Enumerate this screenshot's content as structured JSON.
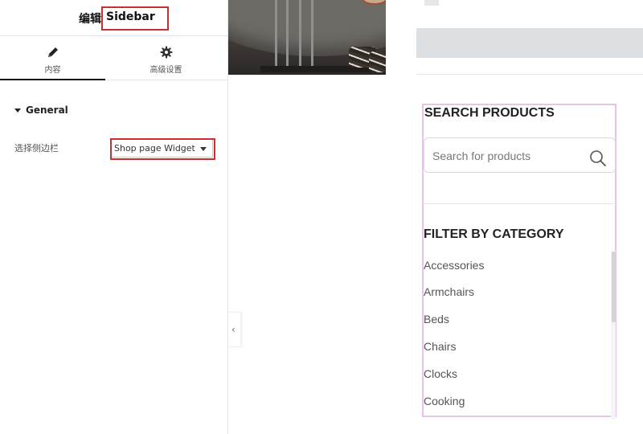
{
  "editor": {
    "title_prefix": "编辑",
    "title_name": "Sidebar",
    "tabs": [
      {
        "label": "内容",
        "icon": "pencil-icon"
      },
      {
        "label": "高级设置",
        "icon": "gear-icon"
      }
    ],
    "section": {
      "label": "General"
    },
    "sidebar_field": {
      "label": "选择侧边栏",
      "value": "Shop page Widget Area"
    },
    "collapse_glyph": "‹"
  },
  "preview": {
    "search": {
      "title": "SEARCH PRODUCTS",
      "placeholder": "Search for products"
    },
    "filter": {
      "title": "FILTER BY CATEGORY",
      "categories": [
        "Accessories",
        "Armchairs",
        "Beds",
        "Chairs",
        "Clocks",
        "Cooking"
      ]
    }
  },
  "colors": {
    "highlight_box": "#cc2f2f",
    "widget_outline": "#e8c3ec",
    "active_tab_underline": "#111111"
  }
}
